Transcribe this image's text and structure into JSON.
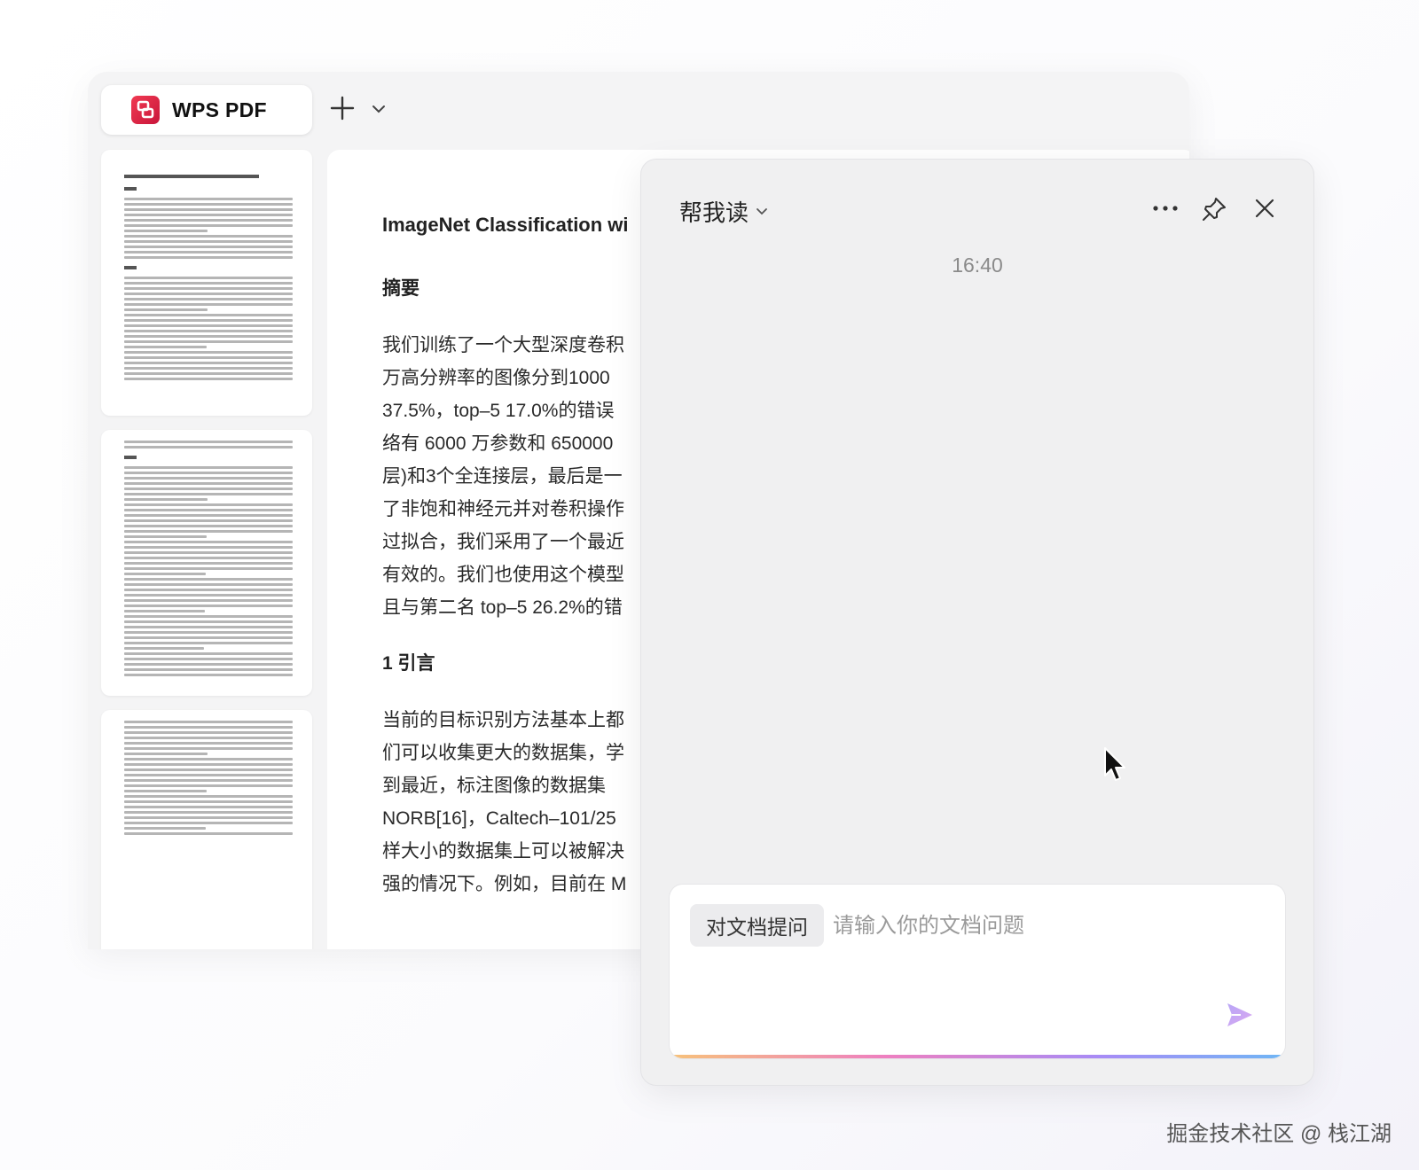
{
  "app": {
    "tab_title": "WPS PDF",
    "brand_color": "#e6254a"
  },
  "document": {
    "title": "ImageNet Classification wi",
    "abstract_heading": "摘要",
    "abstract_lines": [
      "我们训练了一个大型深度卷积",
      "万高分辨率的图像分到1000",
      "37.5%，top–5 17.0%的错误",
      "络有 6000 万参数和 650000",
      "层)和3个全连接层，最后是一",
      "了非饱和神经元并对卷积操作",
      "过拟合，我们采用了一个最近",
      "有效的。我们也使用这个模型",
      "且与第二名 top–5 26.2%的错"
    ],
    "section1_heading": "1 引言",
    "section1_lines": [
      "当前的目标识别方法基本上都",
      "们可以收集更大的数据集，学",
      "到最近，标注图像的数据集",
      "NORB[16]，Caltech–101/25",
      "样大小的数据集上可以被解决",
      "强的情况下。例如，目前在 M"
    ]
  },
  "ai_panel": {
    "mode_label": "帮我读",
    "timestamp": "16:40",
    "input_tag": "对文档提问",
    "input_placeholder": "请输入你的文档问题",
    "icons": [
      "chevron-down-icon",
      "more-icon",
      "pin-icon",
      "close-icon",
      "send-icon"
    ]
  },
  "watermark": "掘金技术社区 @ 栈江湖"
}
